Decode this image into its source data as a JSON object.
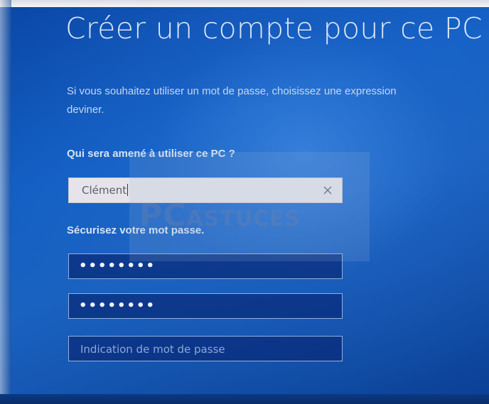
{
  "window": {
    "title": "Créer un compte pour ce PC"
  },
  "intro": {
    "line1": "Si vous souhaitez utiliser un mot de passe, choisissez une expression",
    "line2": "deviner."
  },
  "user_section": {
    "label": "Qui sera amené à utiliser ce PC ?",
    "username_value": "Clément",
    "clear_icon": "close-icon"
  },
  "password_section": {
    "label": "Sécurisez votre mot passe.",
    "password_mask": "••••••••",
    "confirm_mask": "••••••••",
    "hint_placeholder": "Indication de mot de passe"
  },
  "watermark": {
    "brand_part1": "PC",
    "brand_part2": "ASTUCES"
  },
  "colors": {
    "background": "#1360c4",
    "text": "#dbe7f8",
    "input_dark": "#082a78",
    "input_light": "#e6e4ea"
  }
}
